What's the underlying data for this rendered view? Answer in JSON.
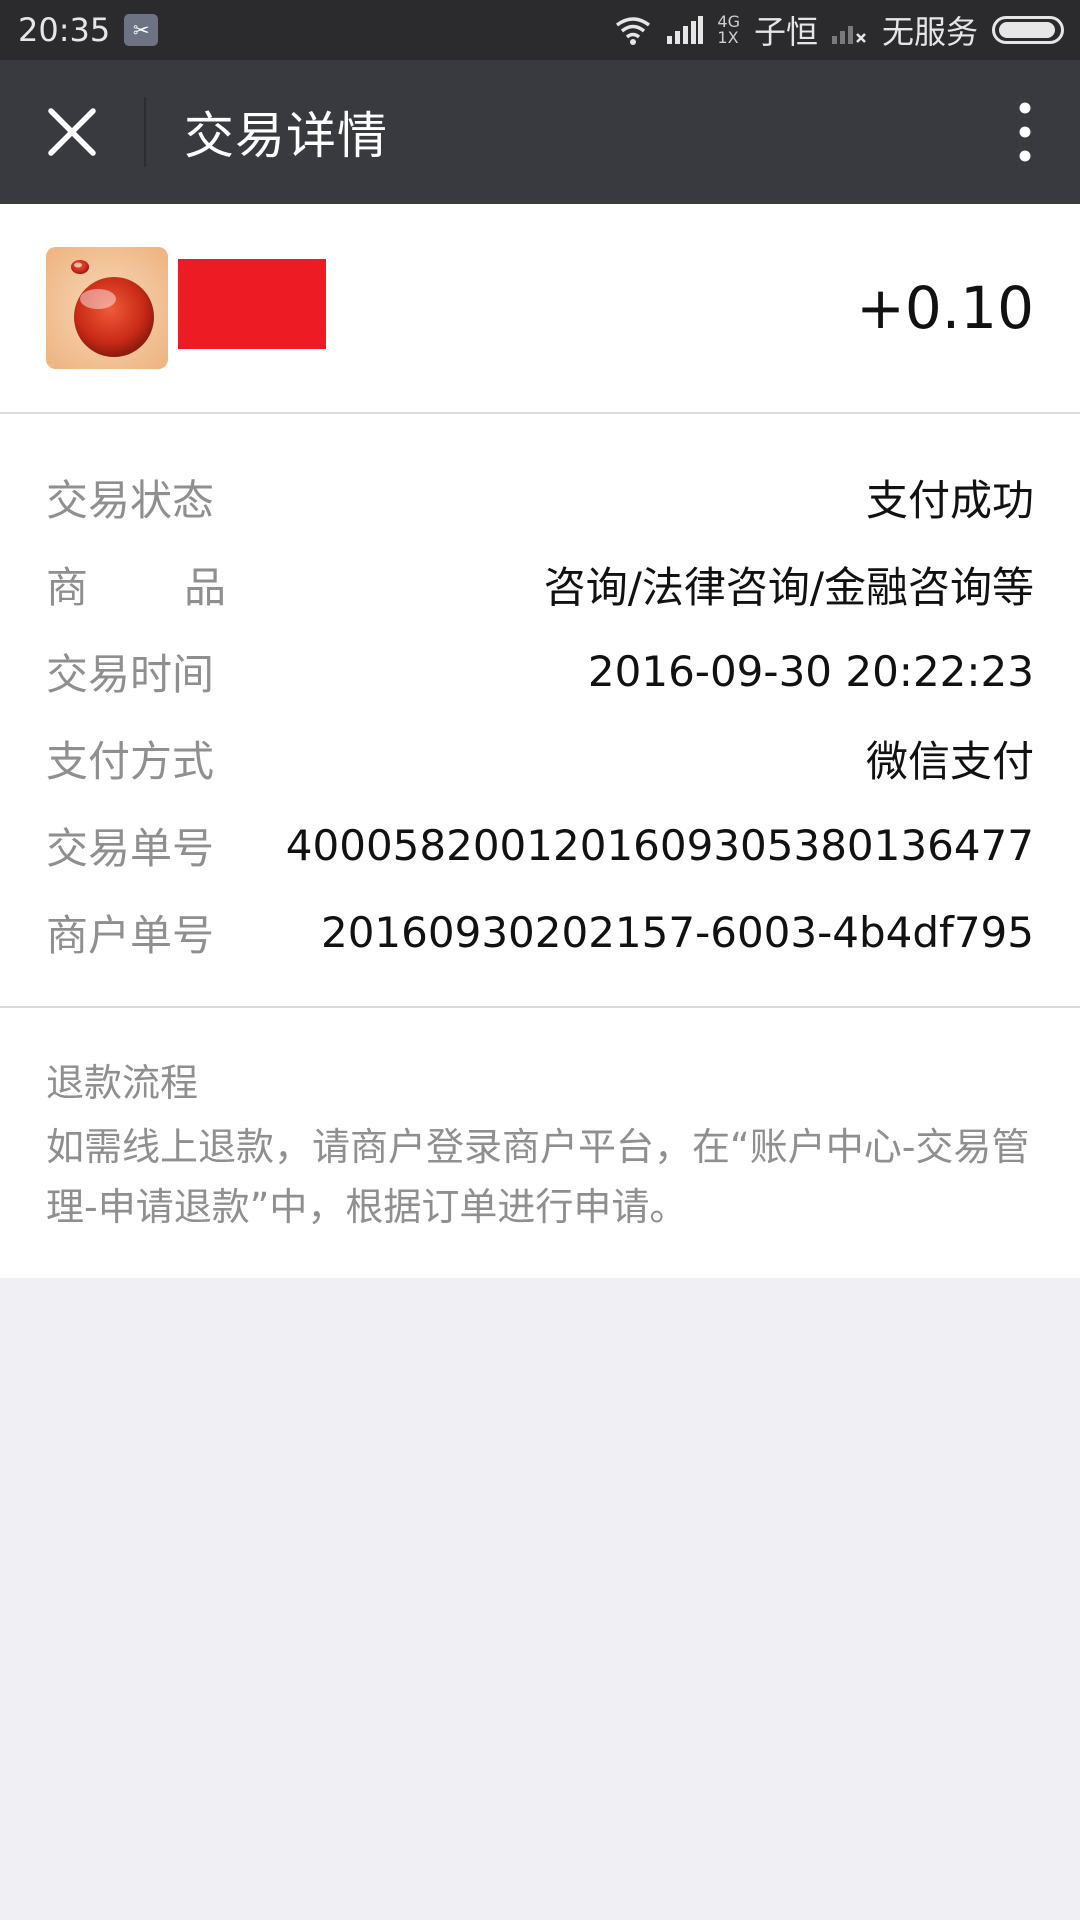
{
  "status_bar": {
    "time": "20:35",
    "notification_icon": "screenshot-icon",
    "network_small_top": "4G",
    "network_small_bottom": "1X",
    "carrier1": "子恒",
    "carrier2": "无服务"
  },
  "nav": {
    "title": "交易详情"
  },
  "merchant": {
    "amount": "+0.10"
  },
  "details": {
    "rows": [
      {
        "label": "交易状态",
        "value": "支付成功"
      },
      {
        "label_chars": [
          "商",
          "品"
        ],
        "value": "咨询/法律咨询/金融咨询等"
      },
      {
        "label": "交易时间",
        "value": "2016-09-30 20:22:23"
      },
      {
        "label": "支付方式",
        "value": "微信支付"
      },
      {
        "label": "交易单号",
        "value": "4000582001201609305380136477"
      },
      {
        "label": "商户单号",
        "value": "20160930202157-6003-4b4df795"
      }
    ]
  },
  "refund": {
    "title": "退款流程",
    "text": "如需线上退款，请商户登录商户平台，在“账户中心-交易管理-申请退款”中，根据订单进行申请。"
  },
  "colors": {
    "nav_bg": "#393a3f",
    "status_bg": "#2b2b2e",
    "redaction": "#ed1c24",
    "page_bg": "#efeff4"
  }
}
